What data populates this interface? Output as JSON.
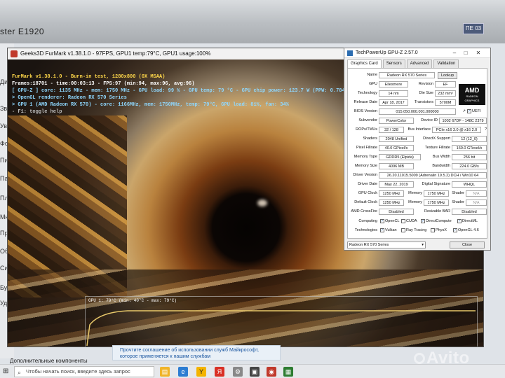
{
  "monitor": {
    "model": "ster E1920",
    "sticker": "ПЕ 03"
  },
  "desktop_left_labels": [
    "Дис",
    "Звук",
    "Увед",
    "Фоку",
    "Пит",
    "Пам",
    "Пла",
    "Мно",
    "Про",
    "Общ",
    "Сис",
    "Буф",
    "Удал"
  ],
  "furmark": {
    "window_title": "Geeks3D FurMark v1.38.1.0 - 97FPS, GPU1 temp:79°C, GPU1 usage:100%",
    "hud": [
      "FurMark v1.38.1.0 - Burn-in test, 1280x800 (0X MSAA)",
      "Frames:18701 - time:00:03:13 - FPS:97 (min:94, max:96, avg:96)",
      "[ GPU-Z ] core: 1135 MHz - mem: 1750 MHz - GPU load: 99 % - GPU temp: 79 °C - GPU chip power: 123.7 W (PPW: 0.784)",
      "> OpenGL renderer: Radeon RX 570 Series",
      "> GPU 1 (AMD Radeon RX 570) - core: 1166MHz, mem: 1750MHz, temp: 79°C, GPU load: 81%, fan: 34%",
      "- F1: toggle help"
    ],
    "graph_label": "GPU 1: 79°C (min: 40°C - max: 79°C)"
  },
  "gpuz": {
    "title": "TechPowerUp GPU-Z 2.57.0",
    "tabs": [
      "Graphics Card",
      "Sensors",
      "Advanced",
      "Validation"
    ],
    "name": "Radeon RX 570 Series",
    "lookup": "Lookup",
    "gpu": "Ellesmere",
    "revision": "EF",
    "technology": "14 nm",
    "die_size": "232 mm²",
    "release_date": "Apr 18, 2017",
    "transistors": "5700M",
    "bios_version": "015.050.000.001.000000",
    "uefi": "UEFI",
    "subvendor": "PowerColor",
    "device_id": "1002 67DF - 148C 2379",
    "rops_tmus": "32 / 128",
    "bus_interface": "PCIe x16 3.0 @ x16 2.0",
    "shaders": "2048 Unified",
    "directx": "12 (12_0)",
    "pixel_fillrate": "40.0 GPixel/s",
    "texture_fillrate": "160.0 GTexel/s",
    "memory_type": "GDDR5 (Elpida)",
    "bus_width": "256 bit",
    "memory_size": "4096 MB",
    "bandwidth": "224.0 GB/s",
    "driver_version": "26.20.11015.5009 (Adrenalin 19.5.2) DCH / Win10 64",
    "driver_date": "May 22, 2019",
    "digital_signature": "WHQL",
    "gpu_clock": "1250 MHz",
    "memory_clock": "1750 MHz",
    "shader": "N/A",
    "default_clock": "1250 MHz",
    "default_memory": "1750 MHz",
    "default_shader": "N/A",
    "crossfire": "Disabled",
    "resizable_bar": "Disabled",
    "labels": {
      "name": "Name",
      "gpu": "GPU",
      "revision": "Revision",
      "technology": "Technology",
      "die_size": "Die Size",
      "release_date": "Release Date",
      "transistors": "Transistors",
      "bios": "BIOS Version",
      "subvendor": "Subvendor",
      "device_id": "Device ID",
      "rops": "ROPs/TMUs",
      "bus": "Bus Interface",
      "shaders": "Shaders",
      "directx": "DirectX Support",
      "pixel": "Pixel Fillrate",
      "texture": "Texture Fillrate",
      "memtype": "Memory Type",
      "buswidth": "Bus Width",
      "memsize": "Memory Size",
      "bandwidth": "Bandwidth",
      "driver": "Driver Version",
      "driverdate": "Driver Date",
      "digsig": "Digital Signature",
      "gpuclock": "GPU Clock",
      "memory": "Memory",
      "shader": "Shader",
      "defclock": "Default Clock",
      "crossfire": "AMD CrossFire",
      "rebar": "Resizable BAR",
      "computing": "Computing",
      "technologies": "Technologies"
    },
    "computing": [
      "OpenCL",
      "CUDA",
      "DirectCompute",
      "DirectML"
    ],
    "computing_checked": [
      true,
      false,
      true,
      true
    ],
    "technologies": [
      "Vulkan",
      "Ray Tracing",
      "PhysX",
      "OpenGL 4.6"
    ],
    "technologies_checked": [
      true,
      false,
      false,
      true
    ],
    "select": "Radeon RX 570 Series",
    "close": "Close",
    "logo_main": "AMD",
    "logo_sub": "RADEON GRAPHICS"
  },
  "notification": {
    "line1": "Прочтите соглашение об использовании служб Майкрософт,",
    "line2": "которое применяется к нашим службам"
  },
  "components_label": "Дополнительные компоненты",
  "taskbar": {
    "search_placeholder": "Чтобы начать поиск, введите здесь запрос"
  },
  "watermark": "Avito"
}
